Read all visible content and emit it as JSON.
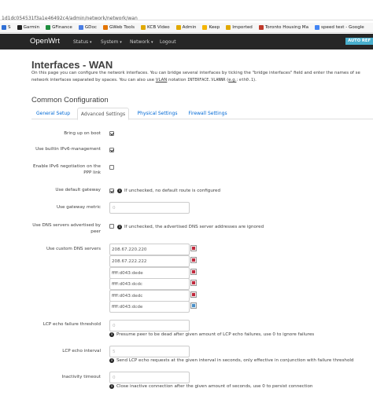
{
  "browser": {
    "url": "1d1dc054531f3a1e46492c4/admin/network/network/wan",
    "bookmarks": [
      {
        "label": "S",
        "color": "#2f6fd6"
      },
      {
        "label": "Garmin",
        "color": "#222222"
      },
      {
        "label": "GFinance",
        "color": "#1e8e3e"
      },
      {
        "label": "GDoc",
        "color": "#4a7de4"
      },
      {
        "label": "GWeb Tools",
        "color": "#e37400"
      },
      {
        "label": "KCB Video",
        "color": "#e0a800"
      },
      {
        "label": "Admin",
        "color": "#e0a800"
      },
      {
        "label": "Keep",
        "color": "#f4b400"
      },
      {
        "label": "Imported",
        "color": "#e0a800"
      },
      {
        "label": "Toronto Housing Ma",
        "color": "#c0392b"
      },
      {
        "label": "speed test - Google",
        "color": "#4285f4"
      }
    ]
  },
  "navbar": {
    "brand": "OpenWrt",
    "items": [
      {
        "label": "Status",
        "caret": "▾"
      },
      {
        "label": "System",
        "caret": "▾"
      },
      {
        "label": "Network",
        "caret": "▾"
      },
      {
        "label": "Logout",
        "caret": ""
      }
    ],
    "autorefresh": "AUTO REF"
  },
  "page": {
    "title": "Interfaces - WAN",
    "desc_line1": "On this page you can configure the network interfaces. You can bridge several interfaces by ticking the \"bridge interfaces\" field and enter the names of se",
    "desc_line2_a": "network interfaces separated by spaces. You can also use ",
    "desc_line2_vlan": "VLAN",
    "desc_line2_b": " notation ",
    "desc_line2_mono1": "INTERFACE.VLANNR",
    "desc_line2_c": " (",
    "desc_line2_eg": "e.g.",
    "desc_line2_d": ": ",
    "desc_line2_mono2": "eth0.1",
    "desc_line2_e": ").",
    "section": "Common Configuration"
  },
  "tabs": [
    {
      "label": "General Setup",
      "active": false
    },
    {
      "label": "Advanced Settings",
      "active": true
    },
    {
      "label": "Physical Settings",
      "active": false
    },
    {
      "label": "Firewall Settings",
      "active": false
    }
  ],
  "form": {
    "bring_up": {
      "label": "Bring up on boot",
      "checked": true
    },
    "ipv6_mgmt": {
      "label": "Use builtin IPv6-management",
      "checked": true
    },
    "ipv6_ppp": {
      "label": "Enable IPv6 negotiation on the PPP link",
      "checked": false
    },
    "default_gw": {
      "label": "Use default gateway",
      "checked": true,
      "help": "If unchecked, no default route is configured"
    },
    "gw_metric": {
      "label": "Use gateway metric",
      "placeholder": "0"
    },
    "peer_dns": {
      "label": "Use DNS servers advertised by peer",
      "checked": false,
      "help": "If unchecked, the advertised DNS server addresses are ignored"
    },
    "custom_dns": {
      "label": "Use custom DNS servers",
      "values": [
        "208.67.220.220",
        "208.67.222.222",
        "ffff:d043:dede",
        "ffff:d043:dcdc",
        "ffff:d043:dedc",
        "ffff:d043:dcde"
      ]
    },
    "lcp_threshold": {
      "label": "LCP echo failure threshold",
      "placeholder": "0",
      "help": "Presume peer to be dead after given amount of LCP echo failures, use 0 to ignore failures"
    },
    "lcp_interval": {
      "label": "LCP echo interval",
      "placeholder": "5",
      "help": "Send LCP echo requests at the given interval in seconds, only effective in conjunction with failure threshold"
    },
    "inactivity": {
      "label": "Inactivity timeout",
      "placeholder": "0",
      "help": "Close inactive connection after the given amount of seconds, use 0 to persist connection"
    }
  }
}
